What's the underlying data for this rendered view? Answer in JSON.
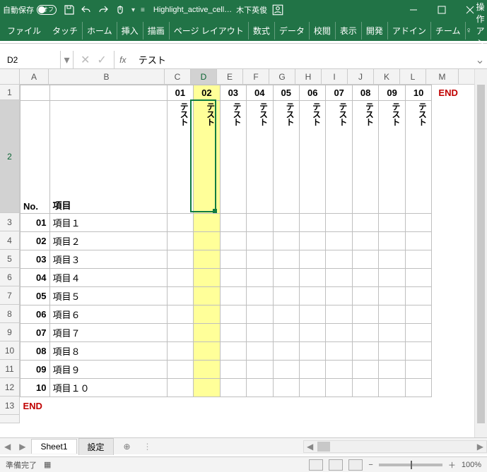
{
  "titlebar": {
    "auto_save": "自動保存",
    "auto_save_state": "オフ",
    "filename": "Highlight_active_cell…",
    "user": "木下英俊"
  },
  "ribbon": {
    "file": "ファイル",
    "tabs": [
      "タッチ",
      "ホーム",
      "挿入",
      "描画",
      "ページ レイアウト",
      "数式",
      "データ",
      "校閲",
      "表示",
      "開発",
      "アドイン",
      "チーム"
    ],
    "tell_me": "操作アシス"
  },
  "namebox": "D2",
  "formula": "テスト",
  "cols": {
    "A": 41,
    "B": 164,
    "C": 37,
    "D": 37,
    "E": 37,
    "F": 37,
    "G": 37,
    "H": 37,
    "I": 37,
    "J": 37,
    "K": 37,
    "L": 37,
    "M": 46
  },
  "row1": {
    "headers": [
      "01",
      "02",
      "03",
      "04",
      "05",
      "06",
      "07",
      "08",
      "09",
      "10"
    ],
    "end": "END"
  },
  "row2": {
    "no_label": "No.",
    "item_label": "項目",
    "tests": [
      "テスト",
      "テスト",
      "テスト",
      "テスト",
      "テスト",
      "テスト",
      "テスト",
      "テスト",
      "テスト",
      "テスト"
    ]
  },
  "items": [
    {
      "no": "01",
      "name": "項目１"
    },
    {
      "no": "02",
      "name": "項目２"
    },
    {
      "no": "03",
      "name": "項目３"
    },
    {
      "no": "04",
      "name": "項目４"
    },
    {
      "no": "05",
      "name": "項目５"
    },
    {
      "no": "06",
      "name": "項目６"
    },
    {
      "no": "07",
      "name": "項目７"
    },
    {
      "no": "08",
      "name": "項目８"
    },
    {
      "no": "09",
      "name": "項目９"
    },
    {
      "no": "10",
      "name": "項目１０"
    }
  ],
  "row13_end": "END",
  "highlight_col_index": 1,
  "selected_cell": "D2",
  "sheet_tabs": {
    "active": "Sheet1",
    "other": "設定"
  },
  "status": {
    "ready": "準備完了",
    "zoom": "100%"
  }
}
